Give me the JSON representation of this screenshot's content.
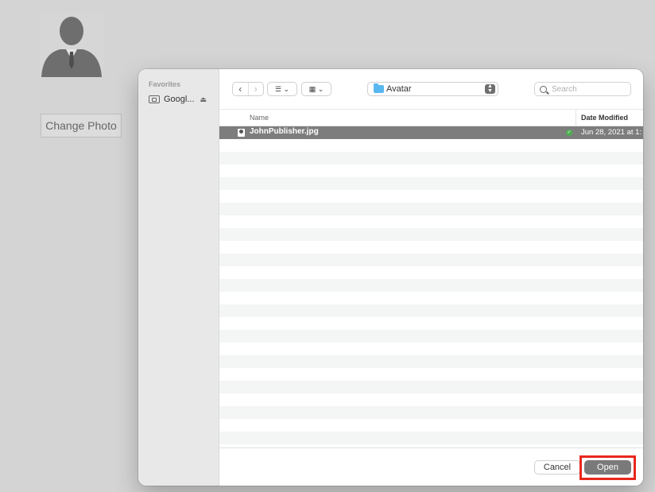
{
  "page": {
    "change_photo_label": "Change Photo"
  },
  "dialog": {
    "sidebar": {
      "heading": "Favorites",
      "items": [
        {
          "label": "Googl...",
          "icon": "drive-icon",
          "eject": "⏏"
        }
      ]
    },
    "toolbar": {
      "back": "‹",
      "forward": "›",
      "list_view": "☰ ⌄",
      "grid_view": "▦ ⌄",
      "location": "Avatar",
      "search_placeholder": "Search"
    },
    "columns": {
      "name": "Name",
      "date": "Date Modified"
    },
    "files": [
      {
        "name": "JohnPublisher.jpg",
        "date": "Jun 28, 2021 at 1:",
        "selected": true
      }
    ],
    "empty_rows": 24,
    "buttons": {
      "cancel": "Cancel",
      "open": "Open"
    }
  }
}
